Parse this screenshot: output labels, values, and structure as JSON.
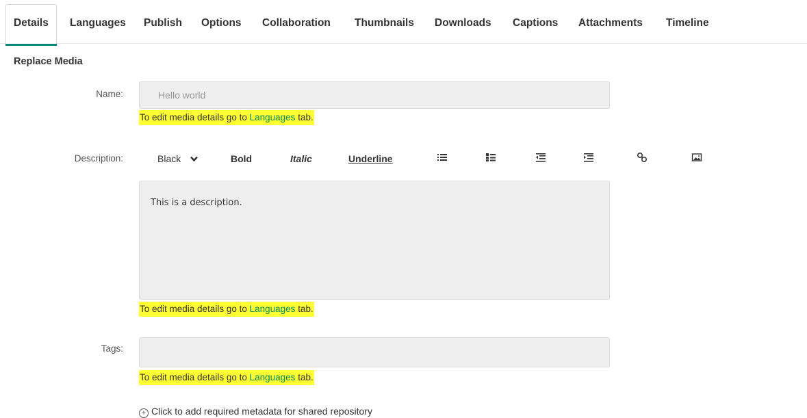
{
  "tabs": [
    {
      "label": "Details",
      "active": true
    },
    {
      "label": "Languages"
    },
    {
      "label": "Publish"
    },
    {
      "label": "Options"
    },
    {
      "label": "Collaboration"
    },
    {
      "label": "Thumbnails"
    },
    {
      "label": "Downloads"
    },
    {
      "label": "Captions"
    },
    {
      "label": "Attachments"
    },
    {
      "label": "Timeline"
    }
  ],
  "section_title": "Replace Media",
  "name": {
    "label": "Name:",
    "value": "Hello world"
  },
  "hint": {
    "prefix": "To edit media details go to ",
    "link": "Languages",
    "suffix": " tab."
  },
  "description": {
    "label": "Description:",
    "value": "This is a description.",
    "toolbar": {
      "color": "Black",
      "bold": "Bold",
      "italic": "Italic",
      "underline": "Underline",
      "icons": [
        "bulleted-list-icon",
        "numbered-list-icon",
        "outdent-icon",
        "indent-icon",
        "link-icon",
        "image-icon"
      ]
    }
  },
  "tags": {
    "label": "Tags:",
    "value": ""
  },
  "metadata_link": "Click to add required metadata for shared repository",
  "colors": {
    "accent": "#00857a",
    "highlight": "#ffff33",
    "link": "#008a5e"
  }
}
